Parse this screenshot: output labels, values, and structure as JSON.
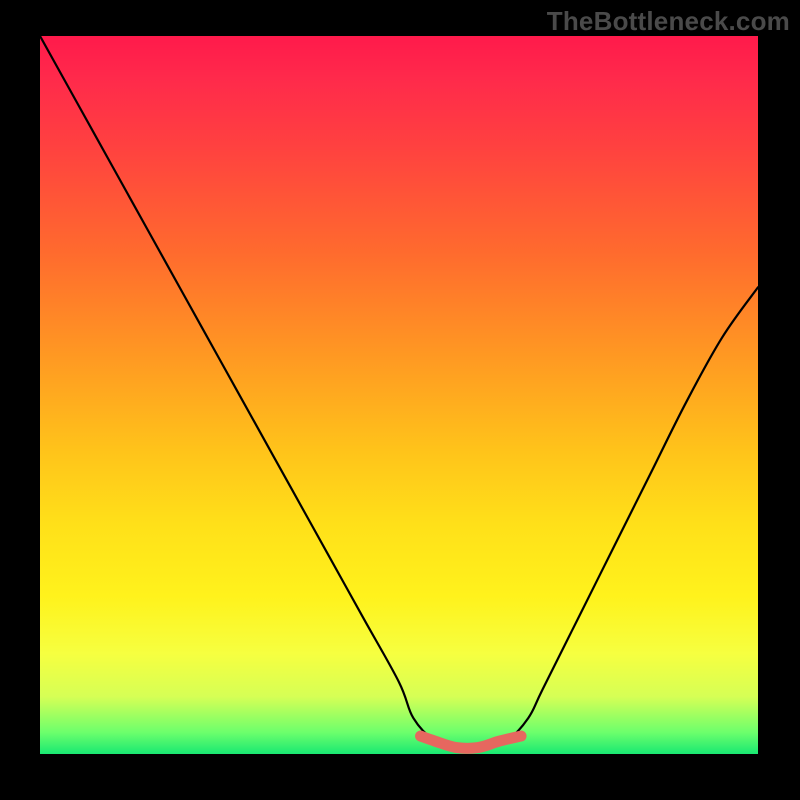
{
  "watermark": {
    "text": "TheBottleneck.com"
  },
  "chart_data": {
    "type": "line",
    "title": "",
    "xlabel": "",
    "ylabel": "",
    "xlim": [
      0,
      100
    ],
    "ylim": [
      0,
      100
    ],
    "series": [
      {
        "name": "curve",
        "x": [
          0,
          5,
          10,
          15,
          20,
          25,
          30,
          35,
          40,
          45,
          50,
          52,
          55,
          58,
          62,
          65,
          68,
          70,
          75,
          80,
          85,
          90,
          95,
          100
        ],
        "values": [
          100,
          91,
          82,
          73,
          64,
          55,
          46,
          37,
          28,
          19,
          10,
          5,
          1.8,
          0.8,
          0.8,
          1.8,
          5,
          9,
          19,
          29,
          39,
          49,
          58,
          65
        ]
      },
      {
        "name": "valley-highlight",
        "x": [
          53,
          55,
          58,
          61,
          64,
          67
        ],
        "values": [
          2.5,
          1.8,
          0.9,
          0.9,
          1.8,
          2.5
        ]
      }
    ],
    "background": {
      "type": "vertical-gradient",
      "stops": [
        {
          "pos": 0.0,
          "color": "#ff1a4b"
        },
        {
          "pos": 0.3,
          "color": "#ff6a2e"
        },
        {
          "pos": 0.58,
          "color": "#ffc41a"
        },
        {
          "pos": 0.86,
          "color": "#f6ff40"
        },
        {
          "pos": 1.0,
          "color": "#19e872"
        }
      ]
    }
  }
}
